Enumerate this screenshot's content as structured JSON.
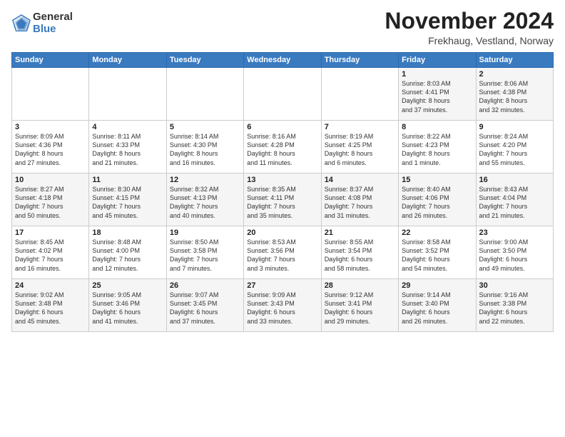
{
  "logo": {
    "general": "General",
    "blue": "Blue"
  },
  "title": "November 2024",
  "subtitle": "Frekhaug, Vestland, Norway",
  "headers": [
    "Sunday",
    "Monday",
    "Tuesday",
    "Wednesday",
    "Thursday",
    "Friday",
    "Saturday"
  ],
  "weeks": [
    [
      {
        "day": "",
        "info": ""
      },
      {
        "day": "",
        "info": ""
      },
      {
        "day": "",
        "info": ""
      },
      {
        "day": "",
        "info": ""
      },
      {
        "day": "",
        "info": ""
      },
      {
        "day": "1",
        "info": "Sunrise: 8:03 AM\nSunset: 4:41 PM\nDaylight: 8 hours\nand 37 minutes."
      },
      {
        "day": "2",
        "info": "Sunrise: 8:06 AM\nSunset: 4:38 PM\nDaylight: 8 hours\nand 32 minutes."
      }
    ],
    [
      {
        "day": "3",
        "info": "Sunrise: 8:09 AM\nSunset: 4:36 PM\nDaylight: 8 hours\nand 27 minutes."
      },
      {
        "day": "4",
        "info": "Sunrise: 8:11 AM\nSunset: 4:33 PM\nDaylight: 8 hours\nand 21 minutes."
      },
      {
        "day": "5",
        "info": "Sunrise: 8:14 AM\nSunset: 4:30 PM\nDaylight: 8 hours\nand 16 minutes."
      },
      {
        "day": "6",
        "info": "Sunrise: 8:16 AM\nSunset: 4:28 PM\nDaylight: 8 hours\nand 11 minutes."
      },
      {
        "day": "7",
        "info": "Sunrise: 8:19 AM\nSunset: 4:25 PM\nDaylight: 8 hours\nand 6 minutes."
      },
      {
        "day": "8",
        "info": "Sunrise: 8:22 AM\nSunset: 4:23 PM\nDaylight: 8 hours\nand 1 minute."
      },
      {
        "day": "9",
        "info": "Sunrise: 8:24 AM\nSunset: 4:20 PM\nDaylight: 7 hours\nand 55 minutes."
      }
    ],
    [
      {
        "day": "10",
        "info": "Sunrise: 8:27 AM\nSunset: 4:18 PM\nDaylight: 7 hours\nand 50 minutes."
      },
      {
        "day": "11",
        "info": "Sunrise: 8:30 AM\nSunset: 4:15 PM\nDaylight: 7 hours\nand 45 minutes."
      },
      {
        "day": "12",
        "info": "Sunrise: 8:32 AM\nSunset: 4:13 PM\nDaylight: 7 hours\nand 40 minutes."
      },
      {
        "day": "13",
        "info": "Sunrise: 8:35 AM\nSunset: 4:11 PM\nDaylight: 7 hours\nand 35 minutes."
      },
      {
        "day": "14",
        "info": "Sunrise: 8:37 AM\nSunset: 4:08 PM\nDaylight: 7 hours\nand 31 minutes."
      },
      {
        "day": "15",
        "info": "Sunrise: 8:40 AM\nSunset: 4:06 PM\nDaylight: 7 hours\nand 26 minutes."
      },
      {
        "day": "16",
        "info": "Sunrise: 8:43 AM\nSunset: 4:04 PM\nDaylight: 7 hours\nand 21 minutes."
      }
    ],
    [
      {
        "day": "17",
        "info": "Sunrise: 8:45 AM\nSunset: 4:02 PM\nDaylight: 7 hours\nand 16 minutes."
      },
      {
        "day": "18",
        "info": "Sunrise: 8:48 AM\nSunset: 4:00 PM\nDaylight: 7 hours\nand 12 minutes."
      },
      {
        "day": "19",
        "info": "Sunrise: 8:50 AM\nSunset: 3:58 PM\nDaylight: 7 hours\nand 7 minutes."
      },
      {
        "day": "20",
        "info": "Sunrise: 8:53 AM\nSunset: 3:56 PM\nDaylight: 7 hours\nand 3 minutes."
      },
      {
        "day": "21",
        "info": "Sunrise: 8:55 AM\nSunset: 3:54 PM\nDaylight: 6 hours\nand 58 minutes."
      },
      {
        "day": "22",
        "info": "Sunrise: 8:58 AM\nSunset: 3:52 PM\nDaylight: 6 hours\nand 54 minutes."
      },
      {
        "day": "23",
        "info": "Sunrise: 9:00 AM\nSunset: 3:50 PM\nDaylight: 6 hours\nand 49 minutes."
      }
    ],
    [
      {
        "day": "24",
        "info": "Sunrise: 9:02 AM\nSunset: 3:48 PM\nDaylight: 6 hours\nand 45 minutes."
      },
      {
        "day": "25",
        "info": "Sunrise: 9:05 AM\nSunset: 3:46 PM\nDaylight: 6 hours\nand 41 minutes."
      },
      {
        "day": "26",
        "info": "Sunrise: 9:07 AM\nSunset: 3:45 PM\nDaylight: 6 hours\nand 37 minutes."
      },
      {
        "day": "27",
        "info": "Sunrise: 9:09 AM\nSunset: 3:43 PM\nDaylight: 6 hours\nand 33 minutes."
      },
      {
        "day": "28",
        "info": "Sunrise: 9:12 AM\nSunset: 3:41 PM\nDaylight: 6 hours\nand 29 minutes."
      },
      {
        "day": "29",
        "info": "Sunrise: 9:14 AM\nSunset: 3:40 PM\nDaylight: 6 hours\nand 26 minutes."
      },
      {
        "day": "30",
        "info": "Sunrise: 9:16 AM\nSunset: 3:38 PM\nDaylight: 6 hours\nand 22 minutes."
      }
    ]
  ]
}
